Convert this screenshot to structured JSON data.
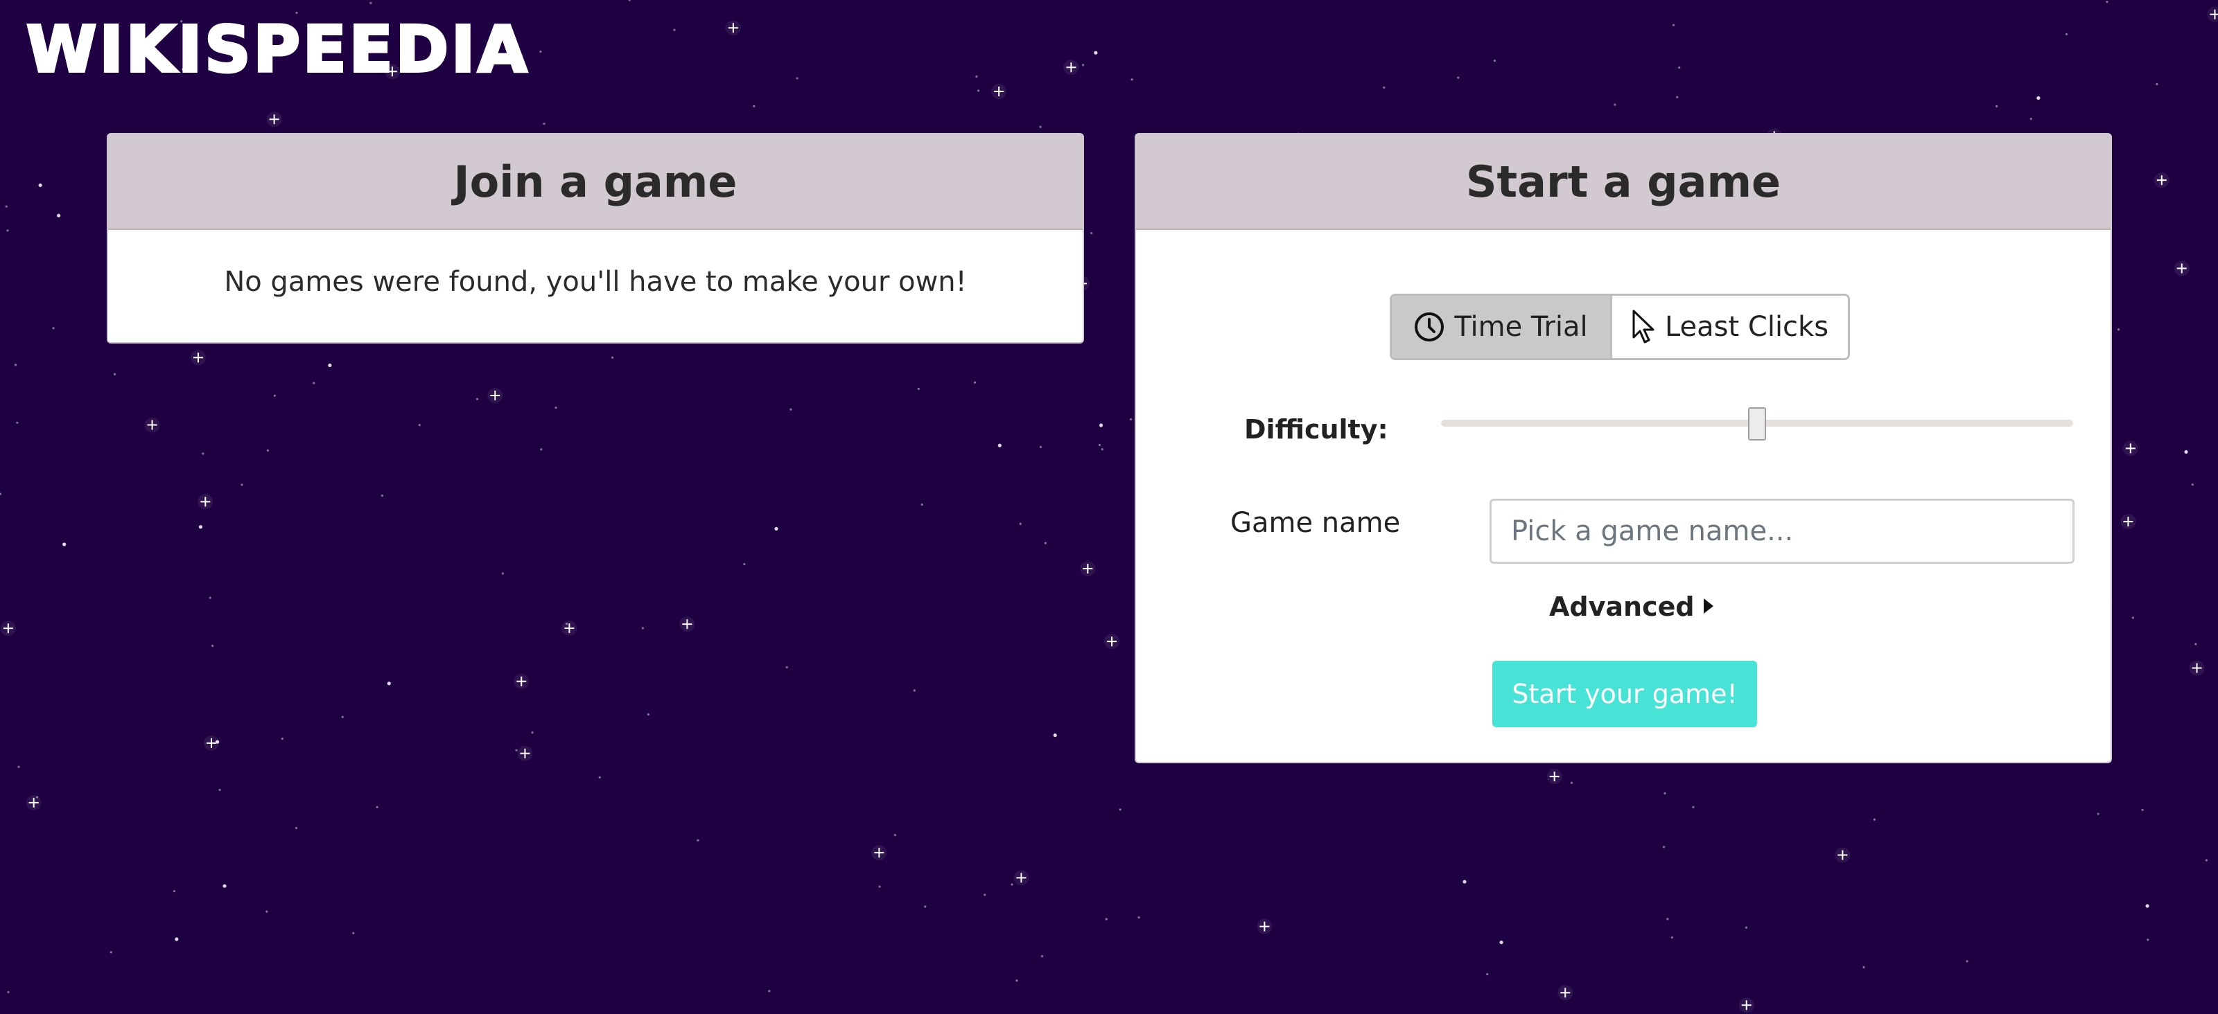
{
  "app": {
    "logo_text": "WIKISPEEDIA"
  },
  "join_panel": {
    "title": "Join a game",
    "empty_message": "No games were found, you'll have to make your own!"
  },
  "start_panel": {
    "title": "Start a game",
    "modes": [
      {
        "label": "Time Trial",
        "icon": "clock-icon",
        "selected": true
      },
      {
        "label": "Least Clicks",
        "icon": "cursor-icon",
        "selected": false
      }
    ],
    "difficulty": {
      "label": "Difficulty:",
      "value_fraction": 0.5
    },
    "game_name": {
      "label": "Game name",
      "placeholder": "Pick a game name...",
      "value": ""
    },
    "advanced": {
      "label": "Advanced",
      "icon": "caret-right-icon",
      "expanded": false
    },
    "start_button_label": "Start your game!"
  },
  "colors": {
    "background": "#1f0042",
    "panel_header": "#d3cad1",
    "start_button": "#47e3d6",
    "active_mode": "#c9c9c9"
  }
}
